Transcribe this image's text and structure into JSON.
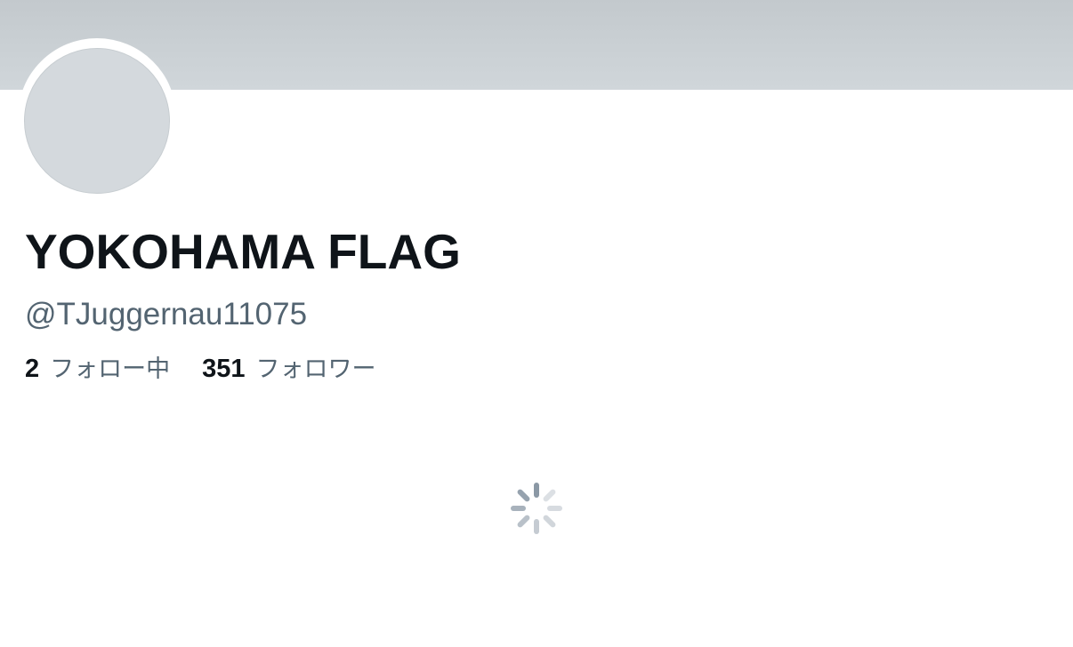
{
  "profile": {
    "display_name": "YOKOHAMA FLAG",
    "handle": "@TJuggernau11075"
  },
  "stats": {
    "following_count": "2",
    "following_label": "フォロー中",
    "followers_count": "351",
    "followers_label": "フォロワー"
  },
  "colors": {
    "banner": "#c8ced2",
    "avatar_placeholder": "#d4d9dd",
    "name_text": "#0f1419",
    "secondary_text": "#536471",
    "spinner": "#8b98a5"
  },
  "loading": {
    "icon": "loading-spinner-icon"
  }
}
